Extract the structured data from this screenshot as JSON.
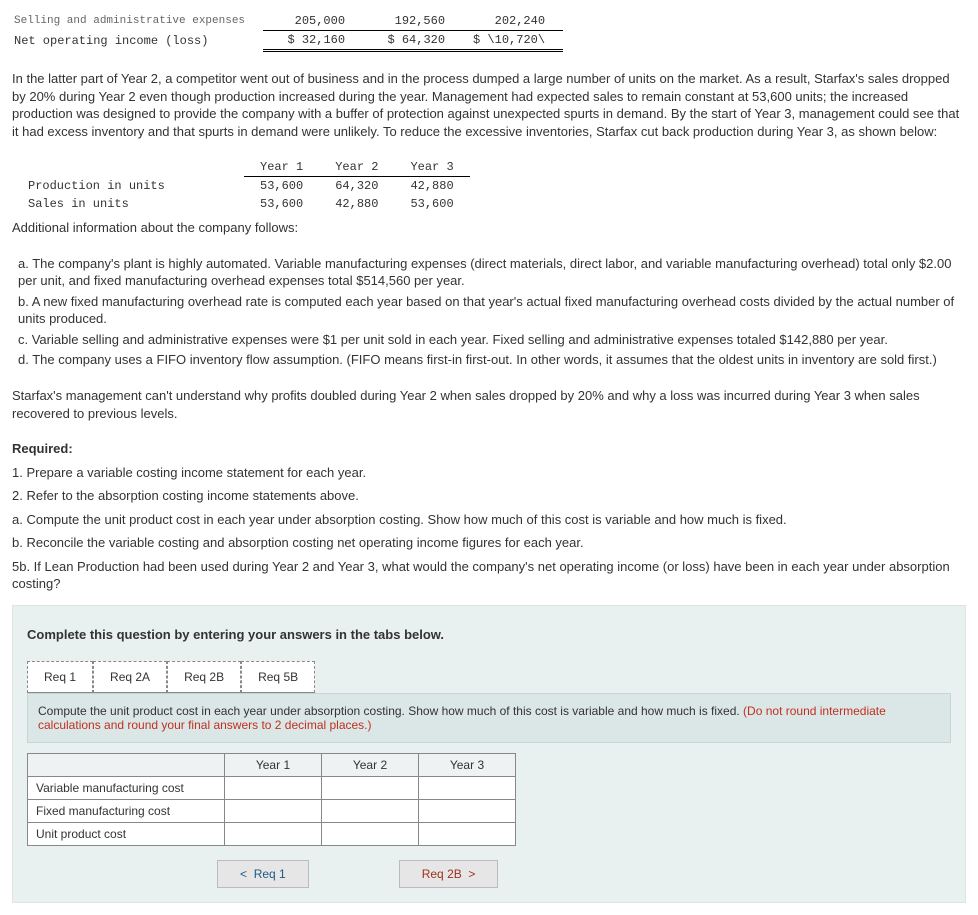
{
  "topTable": {
    "row1_label": "Selling and administrative expenses",
    "row1": [
      "205,000",
      "192,560",
      "202,240"
    ],
    "row2_label": "Net operating income (loss)",
    "row2": [
      "$ 32,160",
      "$ 64,320",
      "$ \\10,720\\"
    ]
  },
  "para1": "In the latter part of Year 2, a competitor went out of business and in the process dumped a large number of units on the market. As a result, Starfax's sales dropped by 20% during Year 2 even though production increased during the year. Management had expected sales to remain constant at 53,600 units; the increased production was designed to provide the company with a buffer of protection against unexpected spurts in demand. By the start of Year 3, management could see that it had excess inventory and that spurts in demand were unlikely. To reduce the excessive inventories, Starfax cut back production during Year 3, as shown below:",
  "prodTable": {
    "headers": [
      "Year 1",
      "Year 2",
      "Year 3"
    ],
    "rows": [
      {
        "label": "Production in units",
        "vals": [
          "53,600",
          "64,320",
          "42,880"
        ]
      },
      {
        "label": "Sales in units",
        "vals": [
          "53,600",
          "42,880",
          "53,600"
        ]
      }
    ]
  },
  "para2": "Additional information about the company follows:",
  "letters": [
    "a. The company's plant is highly automated. Variable manufacturing expenses (direct materials, direct labor, and variable manufacturing overhead) total only $2.00 per unit, and fixed manufacturing overhead expenses total $514,560 per year.",
    "b. A new fixed manufacturing overhead rate is computed each year based on that year's actual fixed manufacturing overhead costs divided by the actual number of units produced.",
    "c. Variable selling and administrative expenses were $1 per unit sold in each year. Fixed selling and administrative expenses totaled $142,880 per year.",
    "d. The company uses a FIFO inventory flow assumption. (FIFO means first-in first-out. In other words, it assumes that the oldest units in inventory are sold first.)"
  ],
  "para3": "Starfax's management can't understand why profits doubled during Year 2 when sales dropped by 20% and why a loss was incurred during Year 3 when sales recovered to previous levels.",
  "requiredLabel": "Required:",
  "requiredItems": [
    "1. Prepare a variable costing income statement for each year.",
    "2. Refer to the absorption costing income statements above.",
    "a. Compute the unit product cost in each year under absorption costing. Show how much of this cost is variable and how much is fixed.",
    "b. Reconcile the variable costing and absorption costing net operating income figures for each year.",
    "5b. If Lean Production had been used during Year 2 and Year 3, what would the company's net operating income (or loss) have been in each year under absorption costing?"
  ],
  "completePrompt": "Complete this question by entering your answers in the tabs below.",
  "tabs": [
    "Req 1",
    "Req 2A",
    "Req 2B",
    "Req 5B"
  ],
  "prompt": {
    "main": "Compute the unit product cost in each year under absorption costing. Show how much of this cost is variable and how much is fixed. ",
    "red": "(Do not round intermediate calculations and round your final answers to 2 decimal places.)"
  },
  "answerTable": {
    "cols": [
      "Year 1",
      "Year 2",
      "Year 3"
    ],
    "rows": [
      "Variable manufacturing cost",
      "Fixed manufacturing cost",
      "Unit product cost"
    ]
  },
  "nav": {
    "prev": "Req 1",
    "next": "Req 2B"
  }
}
